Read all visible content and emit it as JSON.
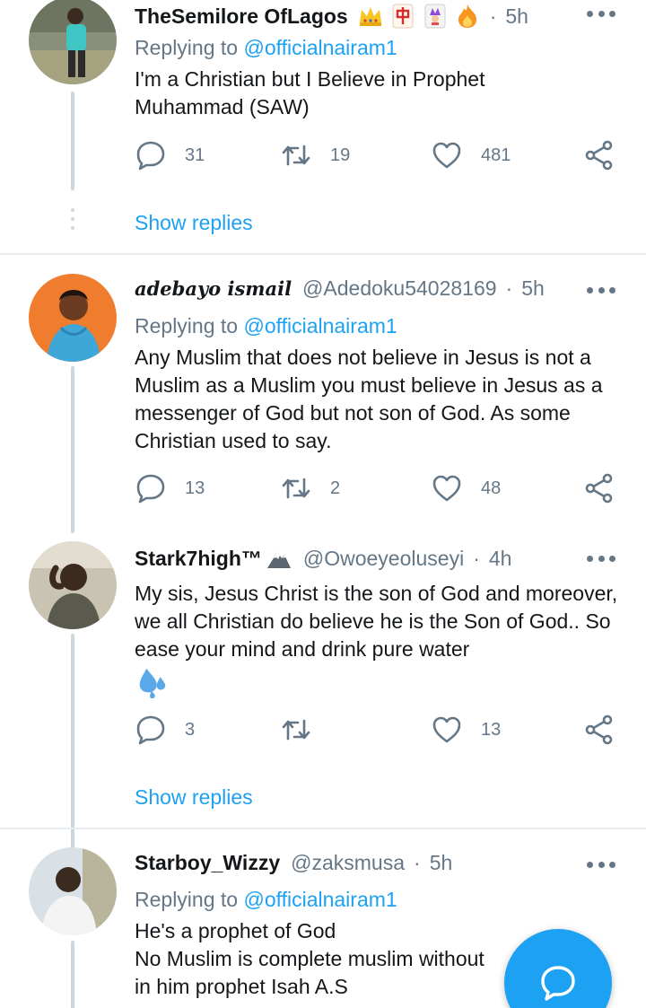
{
  "tweets": [
    {
      "name": "TheSemilore OfLagos",
      "handle": "",
      "time": "5h",
      "emojis": [
        "crown-emoji",
        "mahjong-red-dragon-emoji",
        "joker-card-emoji",
        "fire-emoji"
      ],
      "replying_label": "Replying to",
      "replying_to": "@officialnairam1",
      "text": "I'm a Christian but I Believe in Prophet Muhammad (SAW)",
      "replies": "31",
      "retweets": "19",
      "likes": "481",
      "show_replies": "Show replies"
    },
    {
      "name": "adebayo ismail",
      "handle": "@Adedoku54028169",
      "time": "5h",
      "replying_label": "Replying to",
      "replying_to": "@officialnairam1",
      "text": "Any Muslim that does not believe in Jesus is not a Muslim as a Muslim you must believe in Jesus as a messenger of God but not son of God. As some Christian used to say.",
      "replies": "13",
      "retweets": "2",
      "likes": "48"
    },
    {
      "name": "Stark7high™",
      "handle": "@Owoeyeoluseyi",
      "time": "4h",
      "emojis": [
        "snow-mountain-emoji"
      ],
      "text": "My sis, Jesus Christ is the son of God and moreover, we all Christian do believe he is the Son of God.. So ease your mind and drink pure water",
      "text_emoji": "sweat-droplets-emoji",
      "replies": "3",
      "retweets": "",
      "likes": "13",
      "show_replies": "Show replies"
    },
    {
      "name": "Starboy_Wizzy",
      "handle": "@zaksmusa",
      "time": "5h",
      "replying_label": "Replying to",
      "replying_to": "@officialnairam1",
      "text_line1": "He's a prophet of God",
      "text_line2": "No Muslim is complete muslim without",
      "text_line3": "in him prophet Isah A.S"
    }
  ],
  "separator": "·",
  "colors": {
    "accent": "#1da1f2",
    "muted": "#657786",
    "text": "#14171a",
    "divider": "#e6ecf0"
  },
  "fab_icon": "compose-message-icon"
}
